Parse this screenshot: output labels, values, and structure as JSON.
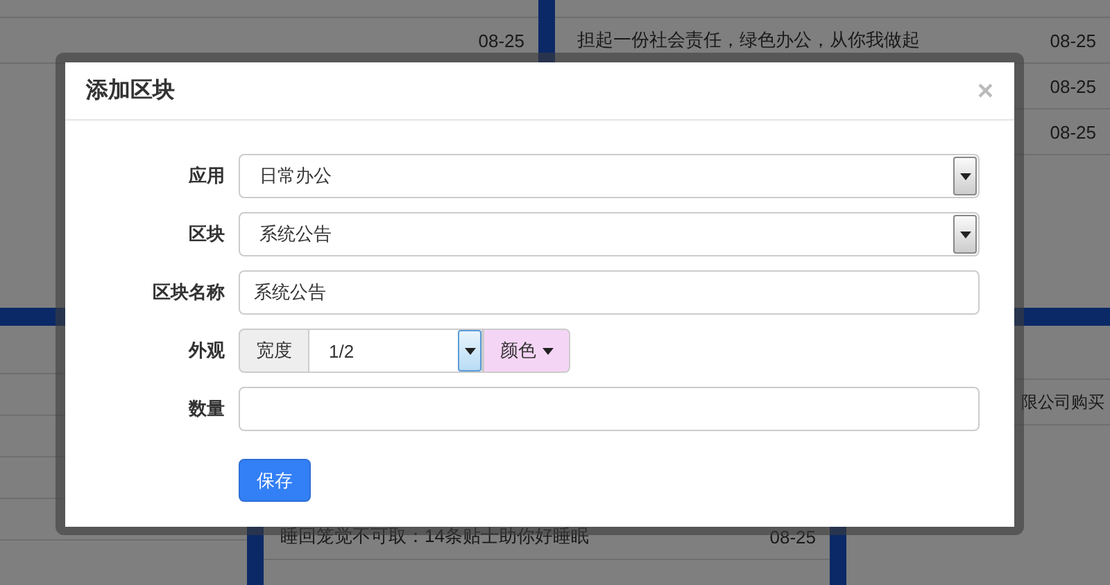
{
  "background": {
    "top_left": {
      "rows": [
        {
          "date": "08-25"
        }
      ]
    },
    "top_right": {
      "rows": [
        {
          "title": "担起一份社会责任，绿色办公，从你我做起",
          "date": "08-25"
        },
        {
          "date": "08-25"
        },
        {
          "date": "08-25"
        }
      ]
    },
    "bottom_middle": {
      "rows": [
        {
          "title": "睡回笼觉不可取：14条贴士助你好睡眠",
          "date": "08-25"
        }
      ]
    },
    "bottom_right": {
      "rows": [
        {
          "title": "限公司购买"
        }
      ]
    }
  },
  "modal": {
    "title": "添加区块",
    "close": "×",
    "fields": [
      {
        "kind": "select",
        "label": "应用",
        "value": "日常办公"
      },
      {
        "kind": "select",
        "label": "区块",
        "value": "系统公告"
      },
      {
        "kind": "text",
        "label": "区块名称",
        "value": "系统公告"
      },
      {
        "kind": "appearance",
        "label": "外观",
        "addon": "宽度",
        "value": "1/2",
        "color_button": "颜色"
      },
      {
        "kind": "text",
        "label": "数量"
      }
    ],
    "save_button": "保存"
  }
}
